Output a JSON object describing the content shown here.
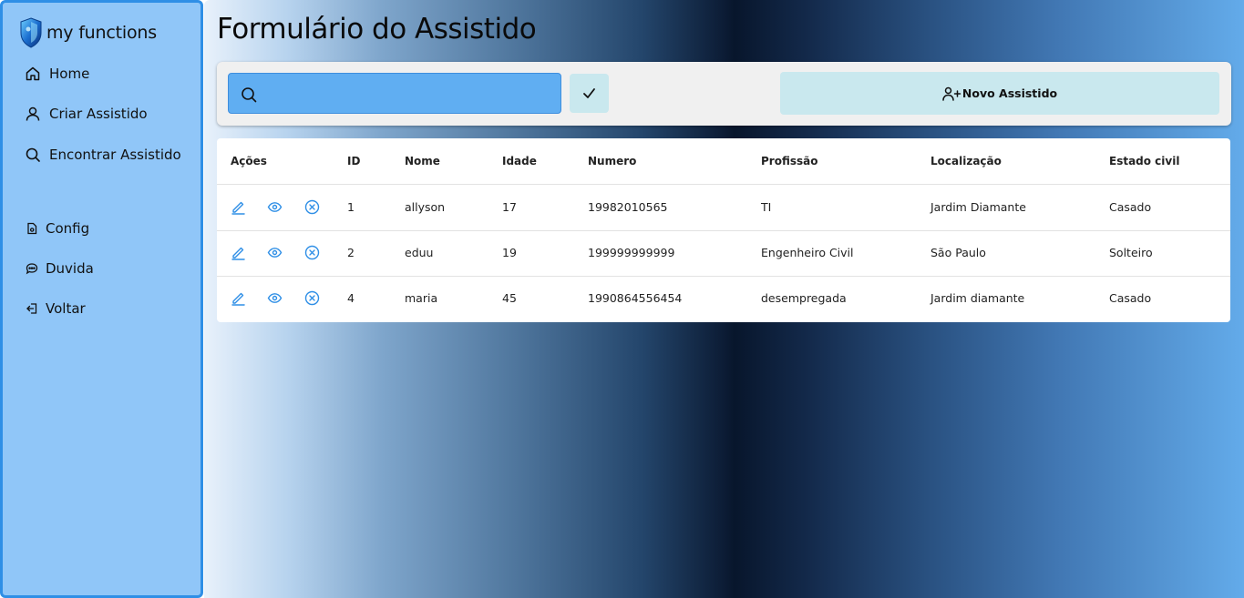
{
  "brand": {
    "name": "my functions"
  },
  "sidebar": {
    "items": [
      {
        "label": "Home",
        "icon": "home-icon"
      },
      {
        "label": "Criar Assistido",
        "icon": "user-icon"
      },
      {
        "label": "Encontrar Assistido",
        "icon": "search-icon"
      },
      {
        "label": "Config",
        "icon": "settings-file-icon"
      },
      {
        "label": "Duvida",
        "icon": "chat-bubble-icon"
      },
      {
        "label": "Voltar",
        "icon": "logout-icon"
      }
    ]
  },
  "page": {
    "title": "Formulário do Assistido"
  },
  "toolbar": {
    "search_value": "",
    "search_placeholder": "",
    "new_button_label": "Novo Assistido"
  },
  "table": {
    "headers": [
      "Ações",
      "ID",
      "Nome",
      "Idade",
      "Numero",
      "Profissão",
      "Localização",
      "Estado civil"
    ],
    "rows": [
      {
        "id": "1",
        "nome": "allyson",
        "idade": "17",
        "numero": "19982010565",
        "profissao": "TI",
        "localizacao": "Jardim Diamante",
        "estado_civil": "Casado"
      },
      {
        "id": "2",
        "nome": "eduu",
        "idade": "19",
        "numero": "199999999999",
        "profissao": "Engenheiro Civil",
        "localizacao": "São Paulo",
        "estado_civil": "Solteiro"
      },
      {
        "id": "4",
        "nome": "maria",
        "idade": "45",
        "numero": "1990864556454",
        "profissao": "desempregada",
        "localizacao": "Jardim diamante",
        "estado_civil": "Casado"
      }
    ]
  },
  "colors": {
    "sidebar_bg": "#90c6f8",
    "sidebar_border": "#2f8fe6",
    "accent": "#2f8fe6",
    "search_bg": "#60aef2",
    "button_bg": "#c9e8ee"
  }
}
